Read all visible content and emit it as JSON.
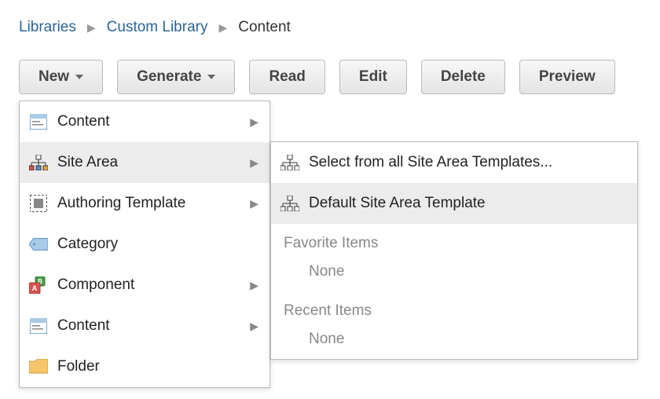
{
  "breadcrumb": {
    "libraries": "Libraries",
    "custom": "Custom Library",
    "content": "Content"
  },
  "toolbar": {
    "new": "New",
    "generate": "Generate",
    "read": "Read",
    "edit": "Edit",
    "delete": "Delete",
    "preview": "Preview"
  },
  "menu1": {
    "content": "Content",
    "sitearea": "Site Area",
    "authoring": "Authoring Template",
    "category": "Category",
    "component": "Component",
    "content2": "Content",
    "folder": "Folder"
  },
  "menu2": {
    "selectAll": "Select from all Site Area Templates...",
    "default": "Default Site Area Template",
    "favHeader": "Favorite Items",
    "favNone": "None",
    "recHeader": "Recent Items",
    "recNone": "None"
  }
}
